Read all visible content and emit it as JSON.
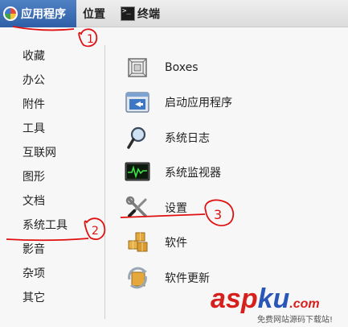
{
  "topbar": {
    "applications": "应用程序",
    "places": "位置",
    "terminal": "终端"
  },
  "categories": [
    {
      "label": "收藏"
    },
    {
      "label": "办公"
    },
    {
      "label": "附件"
    },
    {
      "label": "工具"
    },
    {
      "label": "互联网"
    },
    {
      "label": "图形"
    },
    {
      "label": "文档"
    },
    {
      "label": "系统工具"
    },
    {
      "label": "影音"
    },
    {
      "label": "杂项"
    },
    {
      "label": "其它"
    }
  ],
  "apps": [
    {
      "label": "Boxes",
      "icon": "boxes-icon"
    },
    {
      "label": "启动应用程序",
      "icon": "startup-applications-icon"
    },
    {
      "label": "系统日志",
      "icon": "magnifier-icon"
    },
    {
      "label": "系统监视器",
      "icon": "system-monitor-icon"
    },
    {
      "label": "设置",
      "icon": "tools-icon"
    },
    {
      "label": "软件",
      "icon": "packages-icon"
    },
    {
      "label": "软件更新",
      "icon": "software-update-icon"
    }
  ],
  "annotations": {
    "marks": [
      "1",
      "2",
      "3"
    ],
    "color": "#e01010"
  },
  "watermark": {
    "brand_a": "asp",
    "brand_b": "ku",
    "brand_c": ".com",
    "tagline": "免费网站源码下载站!"
  }
}
